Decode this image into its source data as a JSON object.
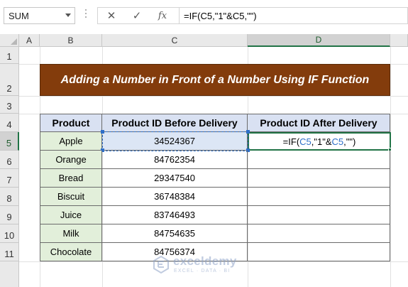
{
  "formula_bar": {
    "name_box": "SUM",
    "cancel_glyph": "✕",
    "enter_glyph": "✓",
    "function_glyph": "fx",
    "formula": "=IF(C5,\"1\"&C5,\"\")"
  },
  "grid": {
    "columns": [
      "A",
      "B",
      "C",
      "D"
    ],
    "rows": [
      "1",
      "2",
      "3",
      "4",
      "5",
      "6",
      "7",
      "8",
      "9",
      "10",
      "11"
    ],
    "selected_column": "D",
    "selected_row": "5"
  },
  "sheet": {
    "title": "Adding a Number in Front of a Number Using IF Function",
    "headers": [
      "Product",
      "Product ID Before Delivery",
      "Product ID After Delivery"
    ],
    "rows": [
      {
        "product": "Apple",
        "id_before": "34524367"
      },
      {
        "product": "Orange",
        "id_before": "84762354"
      },
      {
        "product": "Bread",
        "id_before": "29347540"
      },
      {
        "product": "Biscuit",
        "id_before": "36748384"
      },
      {
        "product": "Juice",
        "id_before": "83746493"
      },
      {
        "product": "Milk",
        "id_before": "84754635"
      },
      {
        "product": "Chocolate",
        "id_before": "84756374"
      }
    ],
    "editing_cell": {
      "prefix": "=IF(",
      "ref1": "C5",
      "middle": ",\"1\"&",
      "ref2": "C5",
      "suffix": ",\"\")"
    }
  },
  "watermark": {
    "name": "exceldemy",
    "tagline": "EXCEL · DATA · BI"
  },
  "colors": {
    "title_bg": "#833c0c",
    "header_bg": "#d9e1f2",
    "product_bg": "#e2efda",
    "excel_green": "#217346",
    "reference_blue": "#2e6fc9"
  }
}
